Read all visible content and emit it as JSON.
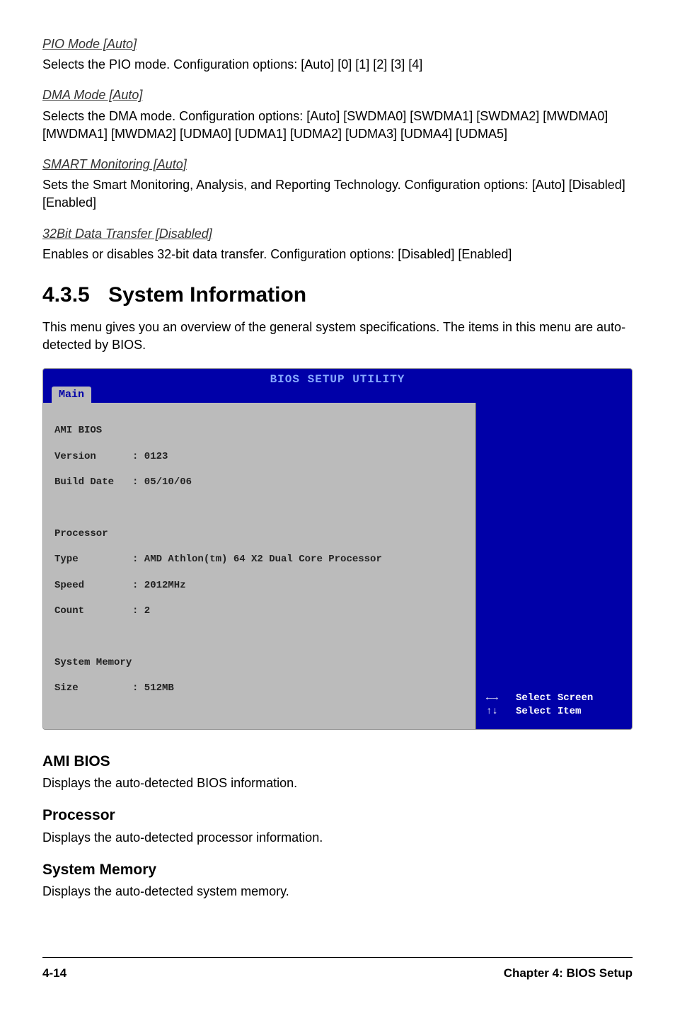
{
  "sec1": {
    "title": "PIO Mode [Auto]",
    "text": "Selects the PIO mode. Configuration options: [Auto] [0] [1] [2] [3] [4]"
  },
  "sec2": {
    "title": "DMA Mode [Auto]",
    "text": "Selects the DMA mode. Configuration options: [Auto] [SWDMA0] [SWDMA1] [SWDMA2] [MWDMA0] [MWDMA1] [MWDMA2] [UDMA0] [UDMA1] [UDMA2] [UDMA3] [UDMA4] [UDMA5]"
  },
  "sec3": {
    "title": "SMART Monitoring [Auto]",
    "text": "Sets the Smart Monitoring, Analysis, and Reporting Technology. Configuration options: [Auto] [Disabled] [Enabled]"
  },
  "sec4": {
    "title": "32Bit Data Transfer [Disabled]",
    "text": "Enables or disables 32-bit data transfer. Configuration options: [Disabled] [Enabled]"
  },
  "heading": {
    "num": "4.3.5",
    "title": "System Information"
  },
  "intro": "This menu gives you an overview of the general system specifications. The items in this menu are auto-detected by BIOS.",
  "bios": {
    "title": "BIOS SETUP UTILITY",
    "tab": "Main",
    "left": {
      "block1_title": "AMI BIOS",
      "version_label": "Version",
      "version_value": ": 0123",
      "build_label": "Build Date",
      "build_value": ": 05/10/06",
      "block2_title": "Processor",
      "type_label": "Type",
      "type_value": ": AMD Athlon(tm) 64 X2 Dual Core Processor",
      "speed_label": "Speed",
      "speed_value": ": 2012MHz",
      "count_label": "Count",
      "count_value": ": 2",
      "block3_title": "System Memory",
      "size_label": "Size",
      "size_value": ": 512MB"
    },
    "right": {
      "arrows1": "←→",
      "line1": "Select Screen",
      "arrows2": "↑↓",
      "line2": "Select Item"
    }
  },
  "sub1": {
    "title": "AMI BIOS",
    "text": "Displays the auto-detected BIOS information."
  },
  "sub2": {
    "title": "Processor",
    "text": "Displays the auto-detected processor information."
  },
  "sub3": {
    "title": "System Memory",
    "text": "Displays the auto-detected system memory."
  },
  "footer": {
    "left": "4-14",
    "right": "Chapter 4: BIOS Setup"
  }
}
